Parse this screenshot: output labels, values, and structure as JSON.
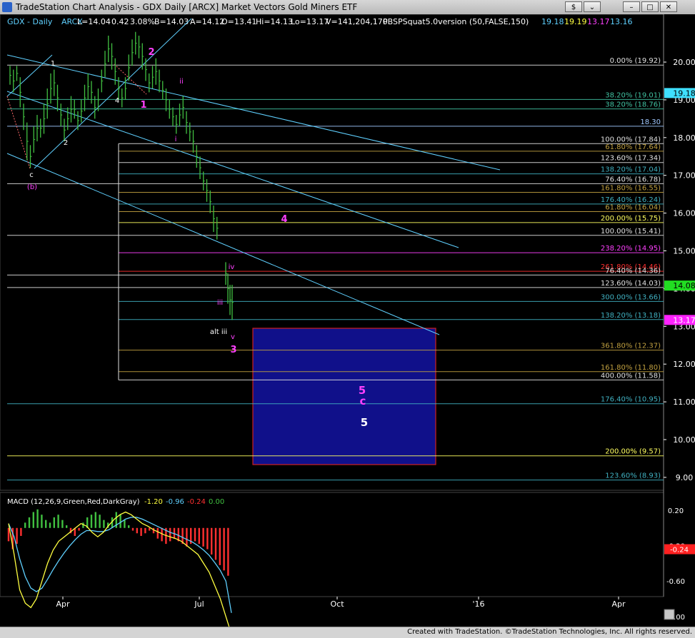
{
  "window": {
    "title": "TradeStation Chart Analysis - GDX Daily [ARCX] Market Vectors Gold Miners ETF",
    "buttons": [
      "$",
      "⌄",
      "–",
      "□",
      "✕"
    ]
  },
  "header": {
    "symbol": "GDX - Daily",
    "exchange": "ARCX",
    "last": "L=14.04",
    "change": "0.42",
    "change_pct": "3.08%",
    "bid": "B=14.03",
    "ask": "A=14.12",
    "open": "O=13.41",
    "high": "Hi=14.13",
    "low": "Lo=13.17",
    "volume": "V=141,204,170",
    "indicator": "PBSPSquat5.0version (50,FALSE,150)",
    "ind_values": [
      {
        "text": "19.18",
        "color": "#5fd0ff"
      },
      {
        "text": "19.19",
        "color": "#ffff40"
      },
      {
        "text": "13.17",
        "color": "#ff40ff"
      },
      {
        "text": "13.16",
        "color": "#5fd0ff"
      }
    ]
  },
  "price_axis": {
    "ticks": [
      "20.00",
      "19.00",
      "18.00",
      "17.00",
      "16.00",
      "15.00",
      "14.00",
      "13.00",
      "12.00",
      "11.00",
      "10.00",
      "9.00"
    ],
    "markers": [
      {
        "text": "19.18",
        "bg": "#3fe0ff",
        "fg": "#000000"
      },
      {
        "text": "14.08",
        "bg": "#22dd22",
        "fg": "#000000"
      },
      {
        "text": "13.17",
        "bg": "#ff22ff",
        "fg": "#ffffff"
      }
    ]
  },
  "date_axis": [
    "Apr",
    "Jul",
    "Oct",
    "'16",
    "Apr"
  ],
  "fib_levels": [
    {
      "label": "0.00% (19.92)",
      "price": 19.92,
      "color": "#e0e0e0"
    },
    {
      "label": "38.20% (19.01)",
      "price": 19.01,
      "color": "#40c0a0"
    },
    {
      "label": "38.20% (18.76)",
      "price": 18.76,
      "color": "#40c0a0"
    },
    {
      "label": "18.30",
      "price": 18.3,
      "color": "#a0c8ff"
    },
    {
      "label": "100.00% (17.84)",
      "price": 17.84,
      "color": "#e0e0e0"
    },
    {
      "label": "61.80% (17.64)",
      "price": 17.64,
      "color": "#c0a040"
    },
    {
      "label": "123.60% (17.34)",
      "price": 17.34,
      "color": "#e0e0e0"
    },
    {
      "label": "138.20% (17.04)",
      "price": 17.04,
      "color": "#40b0c0"
    },
    {
      "label": "76.40% (16.78)",
      "price": 16.78,
      "color": "#e0e0e0"
    },
    {
      "label": "161.80% (16.55)",
      "price": 16.55,
      "color": "#c0a040"
    },
    {
      "label": "176.40% (16.24)",
      "price": 16.24,
      "color": "#40b0c0"
    },
    {
      "label": "61.80% (16.04)",
      "price": 16.04,
      "color": "#c0a040"
    },
    {
      "label": "200.00% (15.75)",
      "price": 15.75,
      "color": "#ffff60"
    },
    {
      "label": "100.00% (15.41)",
      "price": 15.41,
      "color": "#e0e0e0"
    },
    {
      "label": "238.20% (14.95)",
      "price": 14.95,
      "color": "#ff40ff"
    },
    {
      "label": "261.80% (14.46)",
      "price": 14.46,
      "color": "#ff3030"
    },
    {
      "label": "76.40% (14.36)",
      "price": 14.36,
      "color": "#e0e0e0"
    },
    {
      "label": "123.60% (14.03)",
      "price": 14.03,
      "color": "#e0e0e0"
    },
    {
      "label": "300.00% (13.66)",
      "price": 13.66,
      "color": "#40b0c0"
    },
    {
      "label": "138.20% (13.18)",
      "price": 13.18,
      "color": "#40b0c0"
    },
    {
      "label": "361.80% (12.37)",
      "price": 12.37,
      "color": "#c0a040"
    },
    {
      "label": "161.80% (11.80)",
      "price": 11.8,
      "color": "#c0a040"
    },
    {
      "label": "400.00% (11.58)",
      "price": 11.58,
      "color": "#e0e0e0"
    },
    {
      "label": "176.40% (10.95)",
      "price": 10.95,
      "color": "#40b0c0"
    },
    {
      "label": "200.00% (9.57)",
      "price": 9.57,
      "color": "#ffff60"
    },
    {
      "label": "123.60% (8.93)",
      "price": 8.93,
      "color": "#40b0c0"
    }
  ],
  "wave_labels": [
    {
      "text": "1",
      "color": "#ffffff"
    },
    {
      "text": "2",
      "color": "#ffffff"
    },
    {
      "text": "c",
      "color": "#ffffff"
    },
    {
      "text": "(b)",
      "color": "#ff40ff"
    },
    {
      "text": "4",
      "color": "#ffffff"
    },
    {
      "text": "1",
      "color": "#ff40ff"
    },
    {
      "text": "2",
      "color": "#ff40ff"
    },
    {
      "text": "i",
      "color": "#ff40ff"
    },
    {
      "text": "ii",
      "color": "#ff40ff"
    },
    {
      "text": "iii",
      "color": "#ff40ff"
    },
    {
      "text": "iv",
      "color": "#ff40ff"
    },
    {
      "text": "v",
      "color": "#ff40ff"
    },
    {
      "text": "alt iii",
      "color": "#ffffff"
    },
    {
      "text": "3",
      "color": "#ff40ff"
    },
    {
      "text": "4",
      "color": "#ff40ff"
    },
    {
      "text": "5",
      "color": "#ff40ff"
    },
    {
      "text": "c",
      "color": "#ff40ff"
    },
    {
      "text": "5",
      "color": "#ffffff"
    }
  ],
  "macd": {
    "label": "MACD (12,26,9,Green,Red,DarkGray)",
    "values": [
      {
        "text": "-1.20",
        "color": "#ffff40"
      },
      {
        "text": "-0.96",
        "color": "#5fd0ff"
      },
      {
        "text": "-0.24",
        "color": "#ff3030"
      },
      {
        "text": "0.00",
        "color": "#40c040"
      }
    ],
    "ticks": [
      "0.20",
      "-0.20",
      "-0.60",
      "-1.00"
    ],
    "marker": {
      "text": "-0.24",
      "bg": "#ff2020",
      "fg": "#ffffff"
    }
  },
  "status": {
    "text": "Created with TradeStation. ©TradeStation Technologies, Inc. All rights reserved."
  },
  "colors": {
    "background": "#000000",
    "bars": "#40c040",
    "channel": "#5fd0ff",
    "target_box": "#10108a",
    "target_border": "#d02020"
  }
}
